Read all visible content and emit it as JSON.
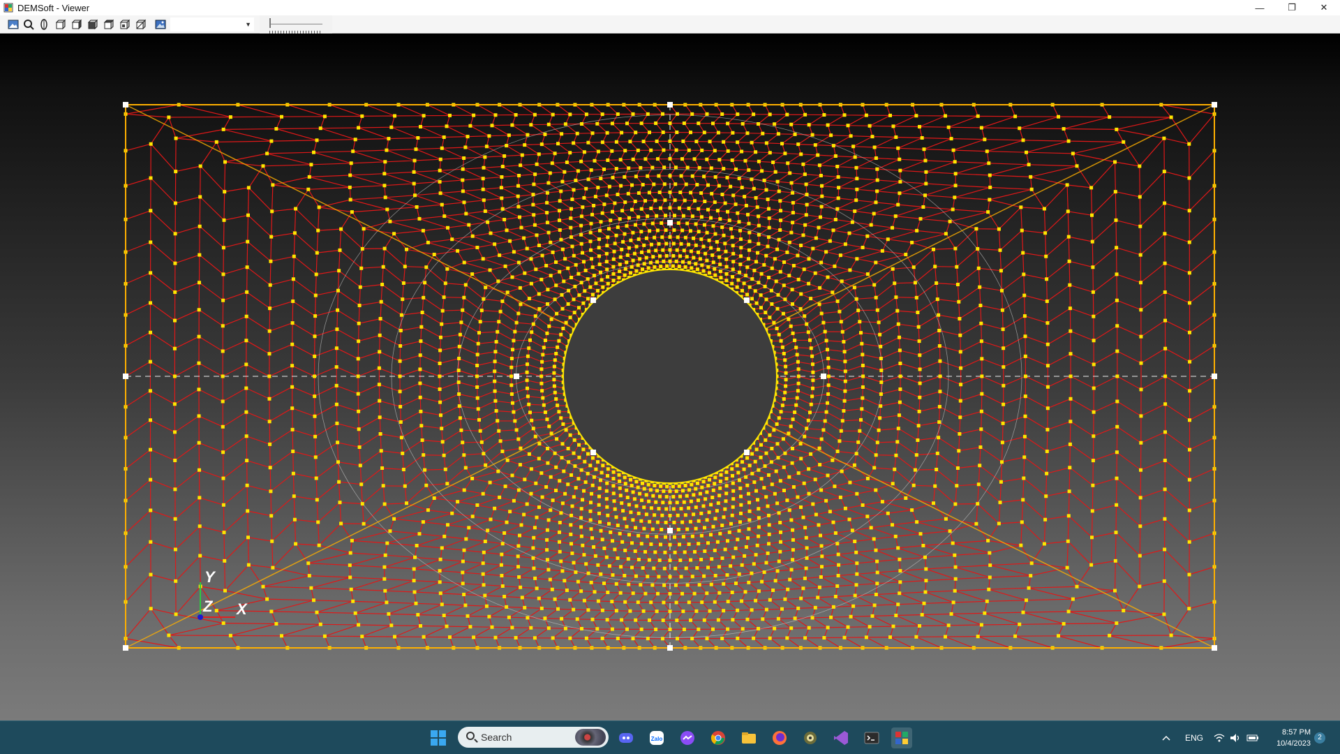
{
  "window": {
    "title": "DEMSoft - Viewer",
    "minimize": "—",
    "restore": "❐",
    "close": "✕"
  },
  "toolbar": {
    "buttons": [
      {
        "icon": "image-icon"
      },
      {
        "icon": "zoom-icon"
      },
      {
        "icon": "rotate-icon"
      },
      {
        "icon": "cube-front-icon"
      },
      {
        "icon": "cube-back-icon"
      },
      {
        "icon": "cube-left-icon"
      },
      {
        "icon": "cube-right-icon"
      },
      {
        "icon": "cube-top-icon"
      },
      {
        "icon": "cube-bottom-icon"
      },
      {
        "icon": "screenshot-icon"
      }
    ],
    "view_select_value": "",
    "value_box": ""
  },
  "viewport": {
    "axis_x": "X",
    "axis_y": "Y",
    "axis_z": "Z",
    "colors": {
      "edge": "#e01818",
      "node": "#ffe600",
      "boundary": "#ffb000",
      "guide": "#cfcfcf",
      "hole": "#3d3d3d"
    }
  },
  "taskbar": {
    "search_placeholder": "Search",
    "apps": [
      "windows-start-icon",
      "discord-icon",
      "zalo-icon",
      "messenger-icon",
      "chrome-icon",
      "file-explorer-icon",
      "firefox-icon",
      "app-icon",
      "visual-studio-icon",
      "terminal-icon",
      "demsoft-icon"
    ],
    "language": "ENG",
    "time": "8:57 PM",
    "date": "10/4/2023",
    "notifications": "2"
  }
}
